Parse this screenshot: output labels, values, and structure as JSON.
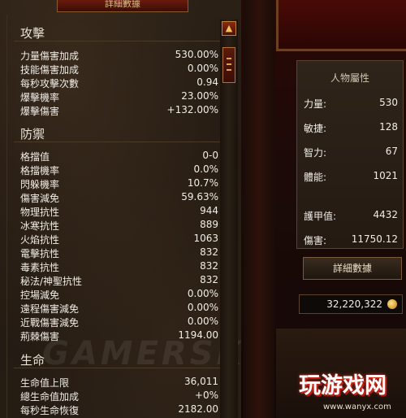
{
  "header": {
    "banner_text": "詳細數據"
  },
  "offense": {
    "title": "攻擊",
    "rows": [
      {
        "label": "力量傷害加成",
        "value": "530.00%"
      },
      {
        "label": "技能傷害加成",
        "value": "0.00%"
      },
      {
        "label": "每秒攻擊次數",
        "value": "0.94"
      },
      {
        "label": "爆擊機率",
        "value": "23.00%"
      },
      {
        "label": "爆擊傷害",
        "value": "+132.00%"
      }
    ]
  },
  "defense": {
    "title": "防禦",
    "rows": [
      {
        "label": "格擋值",
        "value": "0-0"
      },
      {
        "label": "格擋機率",
        "value": "0.0%"
      },
      {
        "label": "閃躲機率",
        "value": "10.7%"
      },
      {
        "label": "傷害減免",
        "value": "59.63%"
      },
      {
        "label": "物理抗性",
        "value": "944"
      },
      {
        "label": "冰寒抗性",
        "value": "889"
      },
      {
        "label": "火焰抗性",
        "value": "1063"
      },
      {
        "label": "電擊抗性",
        "value": "832"
      },
      {
        "label": "毒素抗性",
        "value": "832"
      },
      {
        "label": "秘法/神聖抗性",
        "value": "832"
      },
      {
        "label": "控場減免",
        "value": "0.00%"
      },
      {
        "label": "遠程傷害減免",
        "value": "0.00%"
      },
      {
        "label": "近戰傷害減免",
        "value": "0.00%"
      },
      {
        "label": "荊棘傷害",
        "value": "1194.00"
      }
    ]
  },
  "life": {
    "title": "生命",
    "rows": [
      {
        "label": "生命值上限",
        "value": "36,011"
      },
      {
        "label": "總生命值加成",
        "value": "+0%"
      },
      {
        "label": "每秒生命恢復",
        "value": "2182.00"
      }
    ]
  },
  "attributes": {
    "title": "人物屬性",
    "rows": [
      {
        "label": "力量:",
        "value": "530"
      },
      {
        "label": "敏捷:",
        "value": "128"
      },
      {
        "label": "智力:",
        "value": "67"
      },
      {
        "label": "體能:",
        "value": "1021"
      },
      {
        "label": "護甲值:",
        "value": "4432"
      },
      {
        "label": "傷害:",
        "value": "11750.12"
      }
    ],
    "details_button": "詳細數據"
  },
  "gold": {
    "amount": "32,220,322"
  },
  "branding": {
    "watermark": "GAMERSKY",
    "logo": "玩游戏网",
    "url": "www.wanyx.com"
  },
  "colors": {
    "panel_bg": "#231a12",
    "accent_red": "#8a2a10",
    "gold": "#c08010"
  },
  "icons": {
    "scroll_up": "scroll-up-arrow-icon",
    "gold": "gold-coin-icon"
  }
}
